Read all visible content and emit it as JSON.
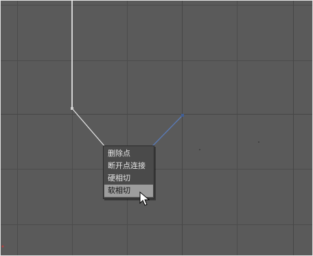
{
  "viewport": {
    "background": "#5a5a5a",
    "grid_color": "#4a4a4a",
    "grid_major_color": "#454545",
    "spline_color": "#ffffff",
    "selected_segment_color": "#5a7ab5",
    "border_color": "#e6e6e6"
  },
  "context_menu": {
    "items": [
      {
        "label": "删除点",
        "active": false
      },
      {
        "label": "断开点连接",
        "active": false
      },
      {
        "label": "硬相切",
        "active": false
      },
      {
        "label": "软相切",
        "active": true
      }
    ]
  }
}
